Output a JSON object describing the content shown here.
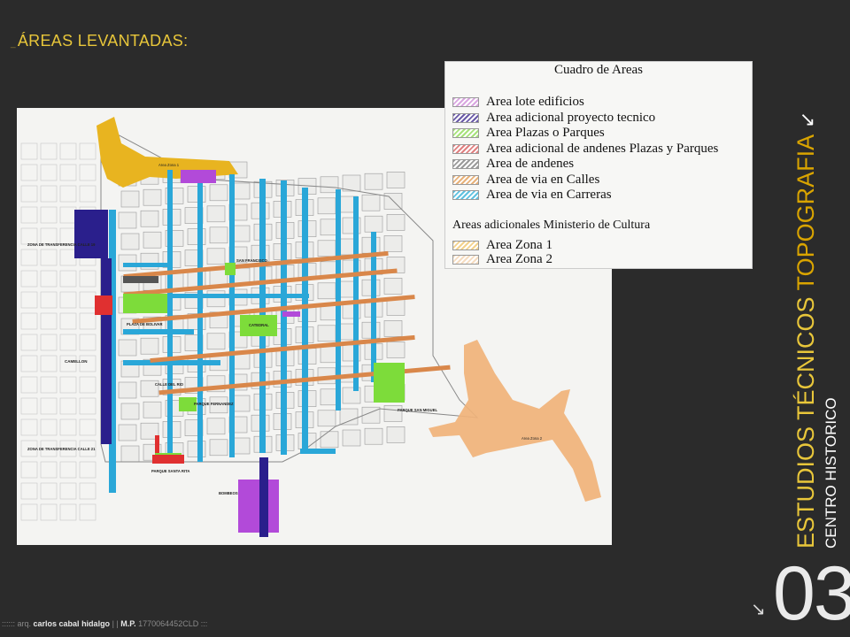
{
  "header": {
    "title": "ÁREAS LEVANTADAS:"
  },
  "legend": {
    "title": "Cuadro de Areas",
    "items": [
      {
        "label": "Area lote edificios",
        "color": "#d9a6e0"
      },
      {
        "label": "Area adicional proyecto tecnico",
        "color": "#6a5aa8"
      },
      {
        "label": "Area  Plazas o Parques",
        "color": "#a6e27a"
      },
      {
        "label": "Area adicional de andenes Plazas y Parques",
        "color": "#e08080"
      },
      {
        "label": "Area de andenes",
        "color": "#9a9a9a"
      },
      {
        "label": "Area de via en Calles",
        "color": "#e8b27a"
      },
      {
        "label": "Area de via en Carreras",
        "color": "#5ec1e0"
      }
    ],
    "section_title": "Areas adicionales Ministerio de Cultura",
    "extra_items": [
      {
        "label": "Area Zona 1",
        "color": "#f3d28c"
      },
      {
        "label": "Area Zona 2",
        "color": "#f5dcc0"
      }
    ]
  },
  "map": {
    "labels": {
      "zona_transferencia_19": "ZONA DE TRANSFERENCIA CALLE 19",
      "zona_transferencia_21": "ZONA DE TRANSFERENCIA CALLE 21",
      "camellon": "CAMELLON",
      "plaza_bolivar": "PLAZA DE BOLIVAR",
      "san_francisco": "SAN FRANCISCO",
      "catedral": "CATEDRAL",
      "calle_rio": "CALLE DEL RIO",
      "parque_fernandez": "PARQUE FERNANDEZ",
      "parque_santa_rita": "PARQUE SANTA RITA",
      "parque_san_miguel": "PARQUE SAN MIGUEL",
      "bombeos": "BOMBEOS",
      "area_zona_1": "Area Zona 1",
      "area_zona_2": "Area Zona 2"
    },
    "colors": {
      "carreras": "#2aa7d8",
      "calles": "#d9874a",
      "parques": "#7ddc3a",
      "lotes": "#b24ad9",
      "proyecto": "#2a1f8c",
      "andenes_rojo": "#e03030",
      "zona1": "#e8b420",
      "zona2": "#f0b27a",
      "andenes_gris": "#555555"
    }
  },
  "side": {
    "title_part1": "ESTUDIOS TÉCNICOS ",
    "title_part2": "TOPOGRAFIA",
    "subtitle": "CENTRO HISTORICO",
    "page_number": "03"
  },
  "footer": {
    "prefix": ":::::: arq.",
    "author": "carlos cabal hidalgo",
    "sep": "| |",
    "mp_label": "M.P.",
    "mp_number": "1770064452CLD",
    "suffix": ":::"
  }
}
